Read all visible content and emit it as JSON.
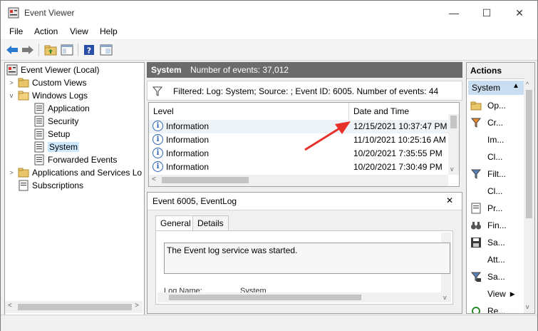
{
  "window": {
    "title": "Event Viewer",
    "minimize": "—",
    "maximize": "☐",
    "close": "✕"
  },
  "menu": [
    "File",
    "Action",
    "View",
    "Help"
  ],
  "toolbar": {
    "icons": [
      "back-icon",
      "forward-icon",
      "up-folder-icon",
      "show-hide-tree-icon",
      "help-icon",
      "properties-icon"
    ]
  },
  "tree": {
    "items": [
      {
        "label": "Event Viewer (Local)"
      },
      {
        "label": "Custom Views"
      },
      {
        "label": "Windows Logs"
      },
      {
        "label": "Application"
      },
      {
        "label": "Security"
      },
      {
        "label": "Setup"
      },
      {
        "label": "System"
      },
      {
        "label": "Forwarded Events"
      },
      {
        "label": "Applications and Services Lo"
      },
      {
        "label": "Subscriptions"
      }
    ]
  },
  "center": {
    "log_name": "System",
    "event_count": "Number of events: 37,012",
    "filter_text": "Filtered: Log: System; Source: ; Event ID: 6005. Number of events: 44",
    "columns": [
      "Level",
      "Date and Time"
    ],
    "rows": [
      {
        "level": "Information",
        "datetime": "12/15/2021 10:37:47 PM"
      },
      {
        "level": "Information",
        "datetime": "11/10/2021 10:25:16 AM"
      },
      {
        "level": "Information",
        "datetime": "10/20/2021 7:35:55 PM"
      },
      {
        "level": "Information",
        "datetime": "10/20/2021 7:30:49 PM"
      }
    ],
    "info_glyph": "i"
  },
  "detail": {
    "title": "Event 6005, EventLog",
    "close": "✕",
    "tabs": [
      "General",
      "Details"
    ],
    "description": "The Event log service was started.",
    "partial_label": "Log Name:",
    "partial_value": "System"
  },
  "actions": {
    "header": "Actions",
    "section": "System",
    "items": [
      "Op...",
      "Cr...",
      "Im...",
      "Cl...",
      "Filt...",
      "Cl...",
      "Pr...",
      "Fin...",
      "Sa...",
      "Att...",
      "Sa...",
      "View",
      "Re..."
    ]
  },
  "colors": {
    "selection": "#cce8ff",
    "header_dark": "#6b6b6b",
    "annotation_arrow": "#e8312a"
  }
}
